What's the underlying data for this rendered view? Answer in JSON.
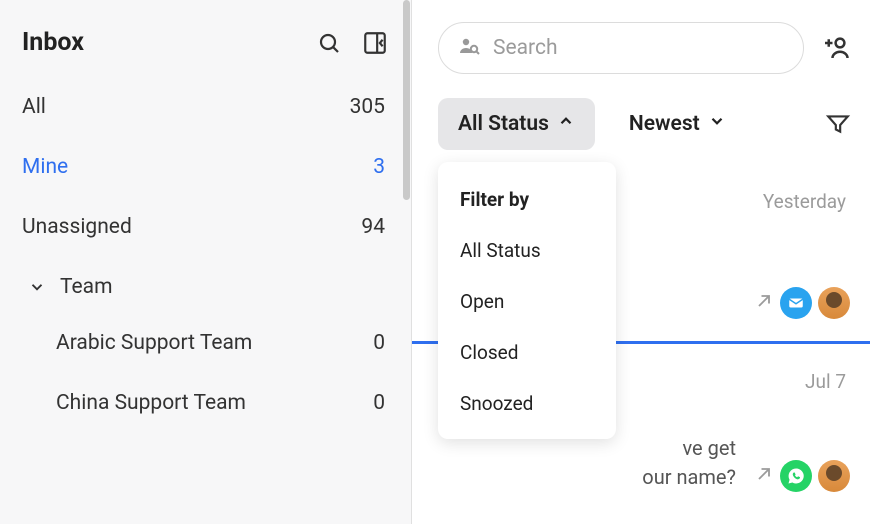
{
  "sidebar": {
    "title": "Inbox",
    "items": [
      {
        "label": "All",
        "count": "305"
      },
      {
        "label": "Mine",
        "count": "3"
      },
      {
        "label": "Unassigned",
        "count": "94"
      }
    ],
    "team_label": "Team",
    "teams": [
      {
        "label": "Arabic Support Team",
        "count": "0"
      },
      {
        "label": "China Support Team",
        "count": "0"
      }
    ]
  },
  "search": {
    "placeholder": "Search"
  },
  "filters": {
    "status_label": "All Status",
    "sort_label": "Newest"
  },
  "status_dropdown": {
    "header": "Filter by",
    "options": [
      "All Status",
      "Open",
      "Closed",
      "Snoozed"
    ]
  },
  "conversations": [
    {
      "time": "Yesterday",
      "channel": "email",
      "preview": ""
    },
    {
      "time": "Jul 7",
      "channel": "whatsapp",
      "preview": "ve get\nour name?"
    }
  ]
}
